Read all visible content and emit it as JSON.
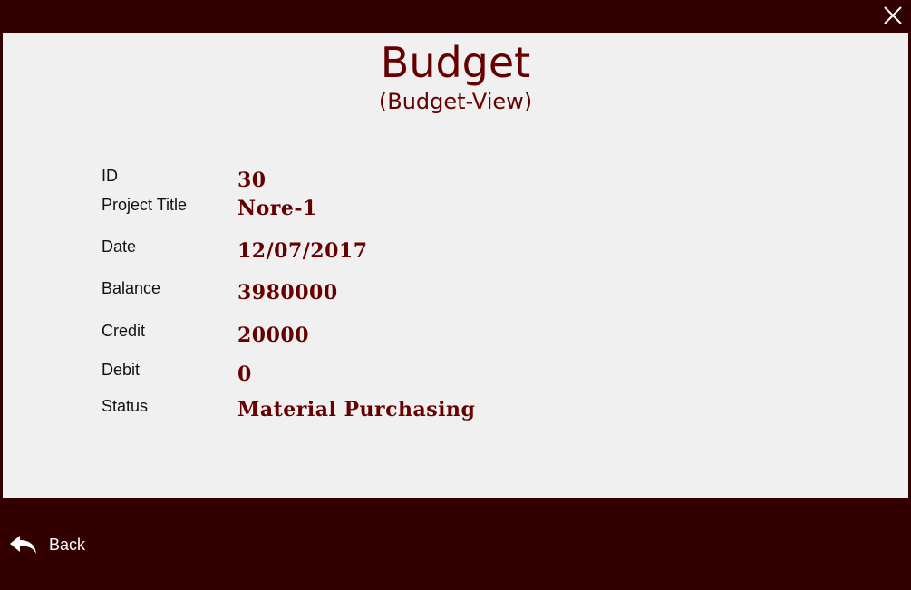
{
  "window": {
    "close_icon": "close-icon"
  },
  "header": {
    "title": "Budget",
    "subtitle": "(Budget-View)"
  },
  "fields": [
    {
      "label": "ID",
      "value": "30"
    },
    {
      "label": "Project Title",
      "value": "Nore-1"
    },
    {
      "label": "Date",
      "value": "12/07/2017"
    },
    {
      "label": "Balance",
      "value": "3980000"
    },
    {
      "label": "Credit",
      "value": "20000"
    },
    {
      "label": "Debit",
      "value": "0"
    },
    {
      "label": "Status",
      "value": "Material Purchasing"
    }
  ],
  "footer": {
    "back_label": "Back",
    "back_icon": "reply-arrow-icon"
  },
  "colors": {
    "frame": "#330000",
    "accent": "#660000",
    "content_bg": "#f0f0f0"
  }
}
